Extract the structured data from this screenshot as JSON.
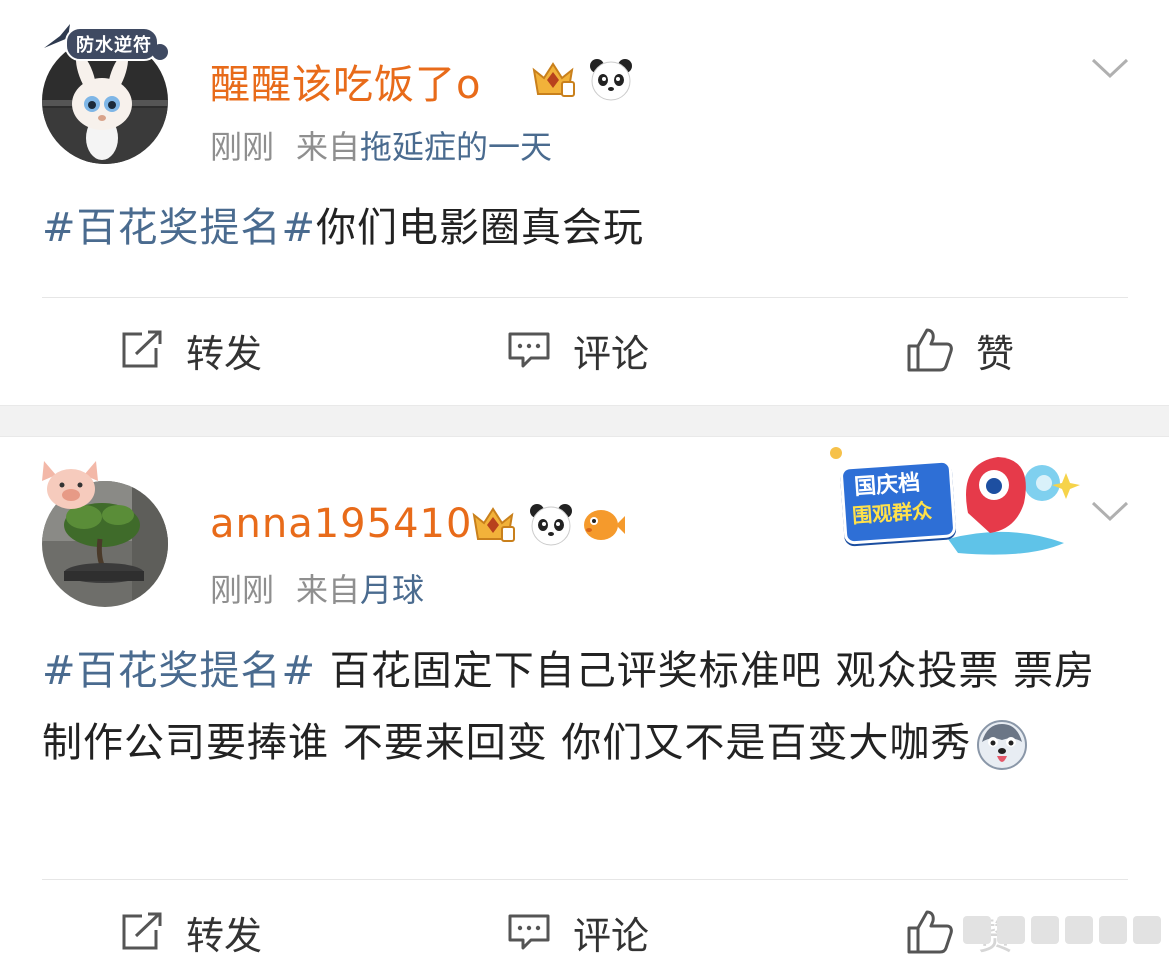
{
  "posts": [
    {
      "username": "醒醒该吃饭了o",
      "time": "刚刚",
      "source_prefix": "来自",
      "source": "拖延症的一天",
      "avatar_banner_text": "防水逆符",
      "content": {
        "topic": "#百花奖提名#",
        "text": "你们电影圈真会玩"
      },
      "actions": {
        "repost": "转发",
        "comment": "评论",
        "like": "赞"
      }
    },
    {
      "username": "anna195410",
      "time": "刚刚",
      "source_prefix": "来自",
      "source": "月球",
      "sticker_text_line1": "国庆档",
      "sticker_text_line2": "围观群众",
      "content": {
        "topic": "#百花奖提名#",
        "text": " 百花固定下自己评奖标准吧 观众投票 票房 制作公司要捧谁 不要来回变 你们又不是百变大咖秀"
      },
      "actions": {
        "repost": "转发",
        "comment": "评论",
        "like": "赞"
      }
    }
  ],
  "colors": {
    "username": "#e86b1a",
    "topic": "#4a6b8f",
    "meta": "#8f8f8f",
    "separator": "#f2f2f2"
  }
}
